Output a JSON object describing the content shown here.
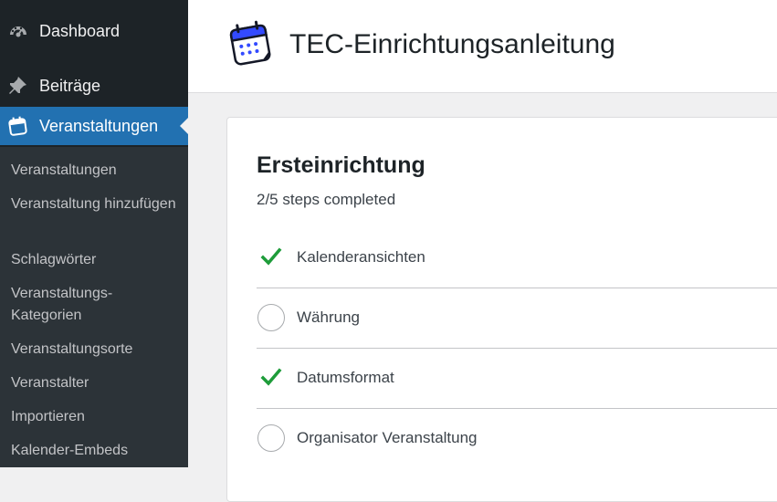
{
  "sidebar": {
    "menu": [
      {
        "label": "Dashboard",
        "icon": "dashboard-icon"
      },
      {
        "label": "Beiträge",
        "icon": "pin-icon"
      },
      {
        "label": "Veranstaltungen",
        "icon": "calendar-icon",
        "current": true
      }
    ],
    "submenu": [
      "Veranstaltungen",
      "Veranstaltung hinzufügen",
      "Schlagwörter",
      "Veranstaltungs-Kategorien",
      "Veranstaltungsorte",
      "Veranstalter",
      "Importieren",
      "Kalender-Embeds"
    ]
  },
  "header": {
    "title": "TEC-Einrichtungsanleitung",
    "icon": "calendar-icon"
  },
  "card": {
    "title": "Ersteinrichtung",
    "progress_text": "2/5 steps completed",
    "steps": [
      {
        "label": "Kalenderansichten",
        "completed": true
      },
      {
        "label": "Währung",
        "completed": false
      },
      {
        "label": "Datumsformat",
        "completed": true
      },
      {
        "label": "Organisator Veranstaltung",
        "completed": false
      }
    ]
  },
  "colors": {
    "sidebar_bg": "#1d2327",
    "submenu_bg": "#2c3338",
    "accent": "#2271b1",
    "check_green": "#1e9c3a",
    "tec_blue": "#334aff"
  }
}
